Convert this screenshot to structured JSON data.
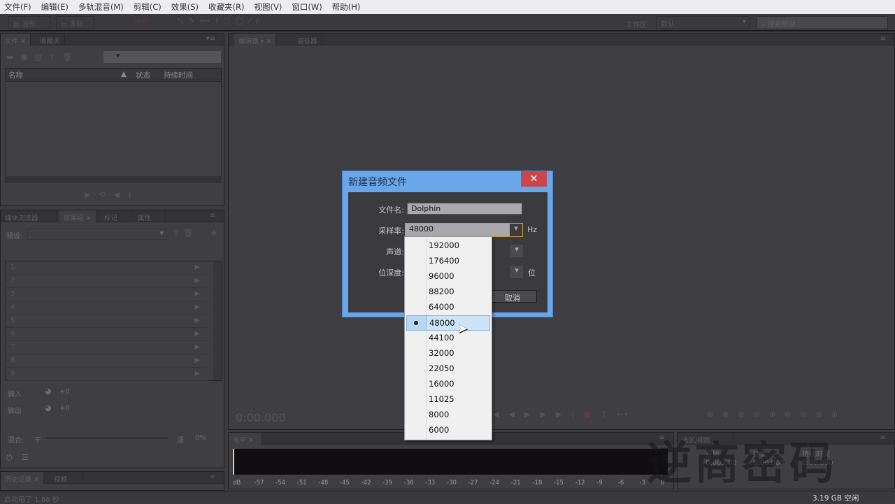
{
  "menu": [
    "文件(F)",
    "编辑(E)",
    "多轨混音(M)",
    "剪辑(C)",
    "效果(S)",
    "收藏夹(R)",
    "视图(V)",
    "窗口(W)",
    "帮助(H)"
  ],
  "toolbar": {
    "waveform": "波形",
    "multitrack": "多轨",
    "workspace_label": "工作区:",
    "workspace_value": "默认",
    "search_placeholder": "搜索帮助"
  },
  "files_panel": {
    "tabs": [
      "文件",
      "收藏夹"
    ],
    "columns": [
      "名称",
      "状态",
      "持续时间"
    ]
  },
  "editor": {
    "tabs": [
      "编辑器",
      "混音器"
    ],
    "time": "0:00.000"
  },
  "effects_panel": {
    "tabs": [
      "媒体浏览器",
      "效果组",
      "标记",
      "属性"
    ],
    "preset_label": "预设:",
    "slots": [
      "1",
      "2",
      "3",
      "4",
      "5",
      "6",
      "7",
      "8",
      "9"
    ],
    "input_label": "输入",
    "output_label": "输出",
    "input_value": "+0",
    "output_value": "+0",
    "mix_label": "混合:",
    "dry": "干",
    "wet": "湿",
    "mix_value": "0%"
  },
  "history_panel": {
    "tabs": [
      "历史记录",
      "视频"
    ],
    "status": "启动用了 1.86 秒"
  },
  "levels_panel": {
    "tab": "电平",
    "scale": [
      "dB",
      "-57",
      "-54",
      "-51",
      "-48",
      "-45",
      "-42",
      "-39",
      "-36",
      "-33",
      "-30",
      "-27",
      "-24",
      "-21",
      "-18",
      "-15",
      "-12",
      "-9",
      "-6",
      "-3",
      "0"
    ]
  },
  "selection_panel": {
    "tab": "选区/视图",
    "columns": [
      "开始",
      "结束",
      "持续时间"
    ],
    "values": [
      "0:00.000",
      "0:00.000",
      "0:00.000"
    ]
  },
  "statusbar": {
    "free_space": "3.19 GB 空闲"
  },
  "dialog": {
    "title": "新建音频文件",
    "filename_label": "文件名:",
    "filename": "Dolphin",
    "samplerate_label": "采样率:",
    "samplerate": "48000",
    "hz": "Hz",
    "channels_label": "声道:",
    "bitdepth_label": "位深度:",
    "bit_unit": "位",
    "cancel": "取消"
  },
  "samplerate_options": [
    "192000",
    "176400",
    "96000",
    "88200",
    "64000",
    "48000",
    "44100",
    "32000",
    "22050",
    "16000",
    "11025",
    "8000",
    "6000"
  ],
  "selected_samplerate": "48000",
  "watermark": "逆商密码"
}
